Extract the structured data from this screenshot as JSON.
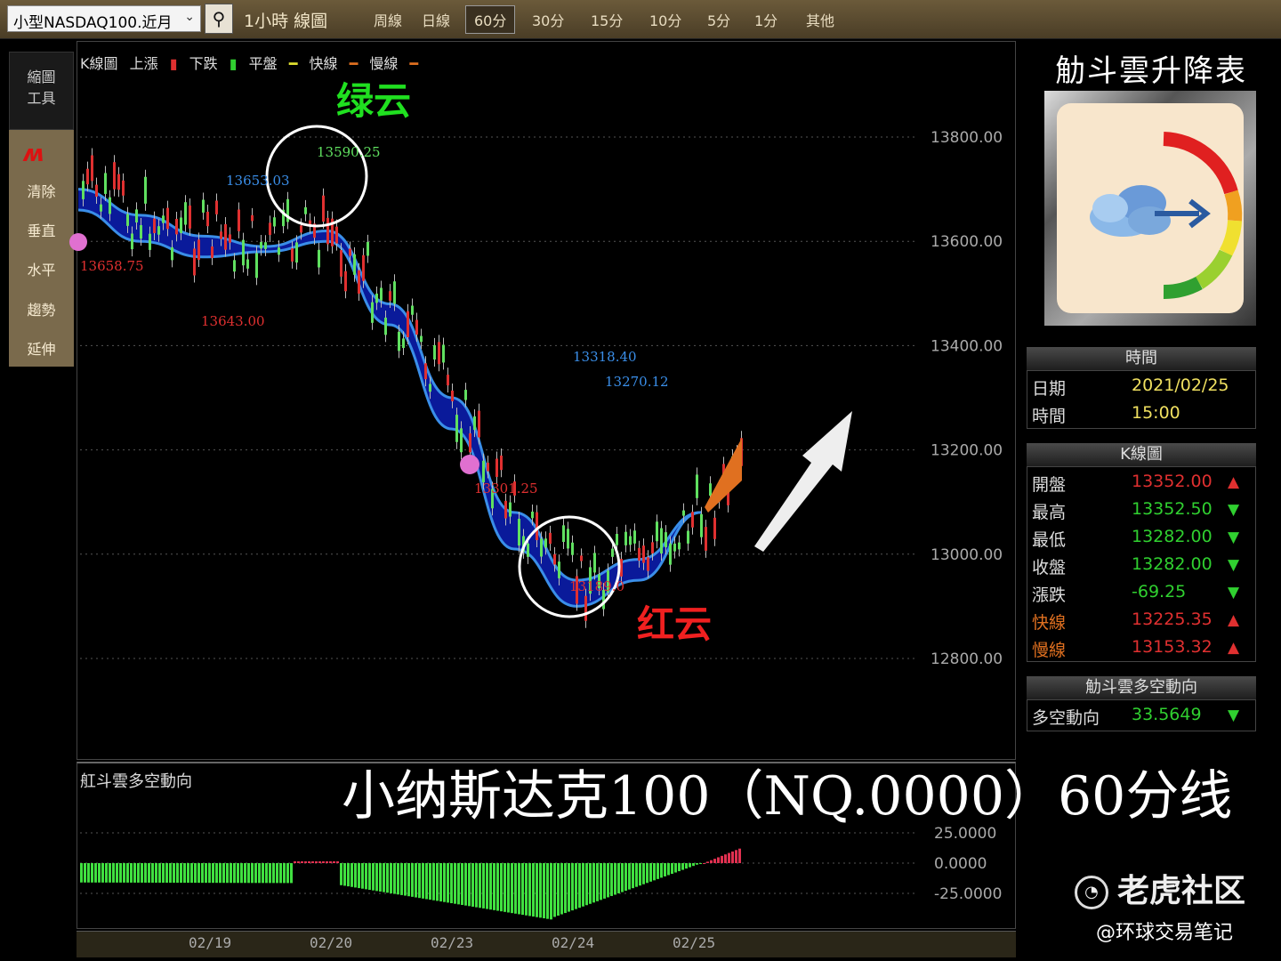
{
  "toolbar": {
    "symbol": "小型NASDAQ100.近月",
    "chart_title": "1小時 線圖",
    "timeframes": [
      "周線",
      "日線",
      "60分",
      "30分",
      "15分",
      "10分",
      "5分",
      "1分",
      "其他"
    ],
    "active_timeframe": "60分"
  },
  "left_panel": {
    "top_label_1": "縮圖",
    "top_label_2": "工具",
    "tools": [
      "清除",
      "垂直",
      "水平",
      "趨勢",
      "延伸"
    ],
    "tool_icon": "trend-draw-icon"
  },
  "legend": {
    "title": "K線圖",
    "items": [
      {
        "label": "上漲",
        "color": "#e03030"
      },
      {
        "label": "下跌",
        "color": "#30d030"
      },
      {
        "label": "平盤",
        "color": "#e0e030"
      },
      {
        "label": "快線",
        "color": "#e07020"
      },
      {
        "label": "慢線",
        "color": "#e07020"
      }
    ]
  },
  "annotations": {
    "green_cloud": "绿云",
    "red_cloud": "红云",
    "labels": [
      "13590.25",
      "13653.03",
      "13658.75",
      "13643.00",
      "13318.40",
      "13270.12",
      "13301.25",
      "13189.0"
    ]
  },
  "chart_data": {
    "type": "line",
    "y_axis_ticks": [
      "13800.00",
      "13600.00",
      "13400.00",
      "13200.00",
      "13000.00",
      "12800.00"
    ],
    "ylim": [
      12700,
      13900
    ],
    "x_ticks": [
      "02/19",
      "02/20",
      "02/23",
      "02/24",
      "02/25"
    ],
    "series": [
      {
        "name": "快線",
        "values": [
          13700,
          13650,
          13610,
          13590,
          13620,
          13480,
          13300,
          13080,
          12950,
          12990,
          13080
        ]
      },
      {
        "name": "慢線",
        "values": [
          13660,
          13600,
          13570,
          13580,
          13600,
          13440,
          13240,
          13010,
          12900,
          12950,
          13080
        ]
      }
    ],
    "indicator": {
      "title": "舡斗雲多空動向",
      "ticks": [
        "25.0000",
        "0.0000",
        "-25.0000"
      ],
      "ylim": [
        -45,
        25
      ]
    }
  },
  "right_panel": {
    "title": "觔斗雲升降表",
    "time_head": "時間",
    "date_label": "日期",
    "date_value": "2021/02/25",
    "time_label": "時間",
    "time_value": "15:00",
    "k_head": "K線圖",
    "rows": [
      {
        "label": "開盤",
        "value": "13352.00",
        "dir": "up"
      },
      {
        "label": "最高",
        "value": "13352.50",
        "dir": "down"
      },
      {
        "label": "最低",
        "value": "13282.00",
        "dir": "down"
      },
      {
        "label": "收盤",
        "value": "13282.00",
        "dir": "down"
      },
      {
        "label": "漲跌",
        "value": "-69.25",
        "dir": "down"
      },
      {
        "label": "快線",
        "value": "13225.35",
        "dir": "up"
      },
      {
        "label": "慢線",
        "value": "13153.32",
        "dir": "up"
      }
    ],
    "trend_head": "觔斗雲多空動向",
    "trend_label": "多空動向",
    "trend_value": "33.5649",
    "trend_dir": "down"
  },
  "caption": "小纳斯达克100（NQ.0000）60分线",
  "watermark": "老虎社区",
  "watermark_sub": "@环球交易笔记",
  "colors": {
    "up": "#e03030",
    "down": "#30d030",
    "cloud_fill": "#0a1a9a",
    "cloud_edge": "#3a8ee8"
  }
}
